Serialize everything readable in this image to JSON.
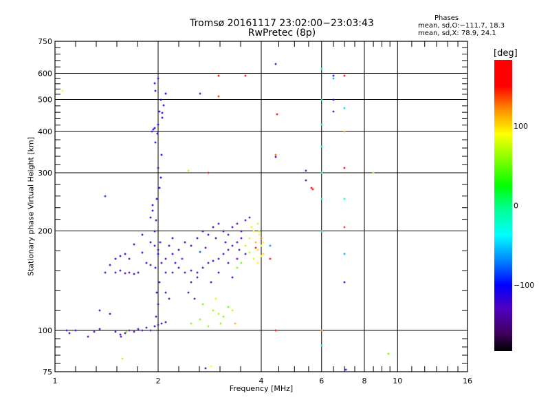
{
  "chart_data": {
    "type": "scatter",
    "title": "Tromsø 20161117 23:02:00−23:03:43",
    "subtitle": "RwPretec (8p)",
    "legend": {
      "heading": "Phases",
      "line_o": "mean, sd,O:−111.7, 18.3",
      "line_x": "mean, sd,X:  78.9, 24.1"
    },
    "xlabel": "Frequency [MHz]",
    "ylabel": "Stationary phase Virtual Height [km]",
    "xscale": "log",
    "yscale": "log",
    "xlim": [
      1,
      16
    ],
    "ylim": [
      75,
      750
    ],
    "xticks": [
      1,
      2,
      4,
      6,
      8,
      10,
      16
    ],
    "xtick_labels": [
      "1",
      "2",
      "4",
      "6",
      "8",
      "10",
      "16"
    ],
    "yticks": [
      75,
      100,
      200,
      300,
      400,
      500,
      600,
      750
    ],
    "ytick_labels": [
      "75",
      "100",
      "200",
      "300",
      "400",
      "500",
      "600",
      "750"
    ],
    "grid": true,
    "colorbar": {
      "unit": "[deg]",
      "range": [
        -183,
        183
      ],
      "ticks": [
        100,
        0,
        -100
      ],
      "tick_labels": [
        "100",
        "0",
        "−100"
      ],
      "stops": [
        [
          -183,
          "#000000"
        ],
        [
          -160,
          "#400060"
        ],
        [
          -130,
          "#5000c0"
        ],
        [
          -100,
          "#0000ff"
        ],
        [
          -70,
          "#0080ff"
        ],
        [
          -37,
          "#00ffff"
        ],
        [
          0,
          "#00ff80"
        ],
        [
          25,
          "#00ff00"
        ],
        [
          90,
          "#ffff00"
        ],
        [
          120,
          "#ff9000"
        ],
        [
          150,
          "#ff0000"
        ],
        [
          183,
          "#ff0000"
        ]
      ]
    },
    "point_fields": [
      "frequency_mhz",
      "height_km",
      "phase_deg"
    ],
    "points": [
      [
        1.08,
        100,
        -125
      ],
      [
        1.1,
        98,
        -120
      ],
      [
        1.15,
        100,
        -110
      ],
      [
        1.3,
        99,
        -130
      ],
      [
        1.35,
        101,
        -125
      ],
      [
        1.5,
        99,
        -110
      ],
      [
        1.55,
        97,
        -135
      ],
      [
        1.6,
        98,
        -130
      ],
      [
        1.65,
        100,
        -130
      ],
      [
        1.7,
        99,
        -130
      ],
      [
        1.75,
        101,
        -130
      ],
      [
        1.8,
        100,
        -130
      ],
      [
        1.85,
        102,
        -130
      ],
      [
        1.9,
        100,
        -125
      ],
      [
        1.95,
        103,
        -120
      ],
      [
        2.0,
        104,
        -125
      ],
      [
        2.05,
        105,
        -120
      ],
      [
        2.1,
        106,
        -125
      ],
      [
        1.56,
        96,
        -130
      ],
      [
        1.62,
        99,
        60
      ],
      [
        1.25,
        96,
        -130
      ],
      [
        1.45,
        112,
        -130
      ],
      [
        1.35,
        115,
        -120
      ],
      [
        1.5,
        150,
        -125
      ],
      [
        1.55,
        152,
        -125
      ],
      [
        1.6,
        149,
        -130
      ],
      [
        1.65,
        150,
        -125
      ],
      [
        1.7,
        148,
        -125
      ],
      [
        1.75,
        150,
        -120
      ],
      [
        1.5,
        165,
        -115
      ],
      [
        1.55,
        168,
        -120
      ],
      [
        1.6,
        170,
        -115
      ],
      [
        1.65,
        165,
        -130
      ],
      [
        1.8,
        172,
        -115
      ],
      [
        1.85,
        160,
        -120
      ],
      [
        1.9,
        158,
        -130
      ],
      [
        1.4,
        150,
        -130
      ],
      [
        1.45,
        158,
        -120
      ],
      [
        1.97,
        110,
        -110
      ],
      [
        2.0,
        120,
        -115
      ],
      [
        1.98,
        130,
        -110
      ],
      [
        2.02,
        140,
        -105
      ],
      [
        1.96,
        155,
        -110
      ],
      [
        2.0,
        170,
        -100
      ],
      [
        2.03,
        185,
        -110
      ],
      [
        1.95,
        200,
        -105
      ],
      [
        1.97,
        215,
        -110
      ],
      [
        1.93,
        230,
        -100
      ],
      [
        1.98,
        250,
        -110
      ],
      [
        2.02,
        270,
        -105
      ],
      [
        2.04,
        290,
        -100
      ],
      [
        2.0,
        310,
        -110
      ],
      [
        2.05,
        340,
        -100
      ],
      [
        1.96,
        370,
        -105
      ],
      [
        1.92,
        400,
        -110
      ],
      [
        1.95,
        410,
        -110
      ],
      [
        2.0,
        420,
        -100
      ],
      [
        2.06,
        440,
        -105
      ],
      [
        2.02,
        460,
        -110
      ],
      [
        2.08,
        480,
        -100
      ],
      [
        2.04,
        500,
        -105
      ],
      [
        1.96,
        530,
        -110
      ],
      [
        1.95,
        560,
        -100
      ],
      [
        2.0,
        580,
        -110
      ],
      [
        1.93,
        240,
        -110
      ],
      [
        1.9,
        220,
        -105
      ],
      [
        1.94,
        405,
        -105
      ],
      [
        2.06,
        455,
        -110
      ],
      [
        2.1,
        520,
        -100
      ],
      [
        1.99,
        395,
        -120
      ],
      [
        2.2,
        150,
        -125
      ],
      [
        2.3,
        155,
        -120
      ],
      [
        2.4,
        150,
        -125
      ],
      [
        2.5,
        152,
        -130
      ],
      [
        2.6,
        150,
        -120
      ],
      [
        2.7,
        155,
        -125
      ],
      [
        2.8,
        160,
        -120
      ],
      [
        2.9,
        162,
        -120
      ],
      [
        3.0,
        165,
        -130
      ],
      [
        3.1,
        170,
        -120
      ],
      [
        3.2,
        175,
        -125
      ],
      [
        3.3,
        180,
        -120
      ],
      [
        3.4,
        185,
        -125
      ],
      [
        3.5,
        190,
        -130
      ],
      [
        2.2,
        170,
        -115
      ],
      [
        2.3,
        175,
        -110
      ],
      [
        2.4,
        185,
        -110
      ],
      [
        2.5,
        180,
        -120
      ],
      [
        2.6,
        190,
        -115
      ],
      [
        2.7,
        200,
        -110
      ],
      [
        2.8,
        195,
        -115
      ],
      [
        2.9,
        205,
        -120
      ],
      [
        3.0,
        210,
        -125
      ],
      [
        3.1,
        200,
        -120
      ],
      [
        3.2,
        195,
        -125
      ],
      [
        3.3,
        205,
        -130
      ],
      [
        3.4,
        210,
        -125
      ],
      [
        3.5,
        200,
        -130
      ],
      [
        3.6,
        215,
        -125
      ],
      [
        3.7,
        220,
        -125
      ],
      [
        2.5,
        140,
        -130
      ],
      [
        2.6,
        145,
        -125
      ],
      [
        2.85,
        140,
        -120
      ],
      [
        3.0,
        150,
        -110
      ],
      [
        3.2,
        160,
        -130
      ],
      [
        3.4,
        165,
        -125
      ],
      [
        3.6,
        170,
        -120
      ],
      [
        3.3,
        145,
        -105
      ],
      [
        2.35,
        165,
        -90
      ],
      [
        2.65,
        173,
        -80
      ],
      [
        2.45,
        130,
        -120
      ],
      [
        2.55,
        125,
        -130
      ],
      [
        2.0,
        175,
        -120
      ],
      [
        2.05,
        160,
        -125
      ],
      [
        2.1,
        165,
        -130
      ],
      [
        2.15,
        180,
        -120
      ],
      [
        2.2,
        190,
        -110
      ],
      [
        2.1,
        150,
        -125
      ],
      [
        1.8,
        195,
        -115
      ],
      [
        1.9,
        185,
        -110
      ],
      [
        1.95,
        180,
        -120
      ],
      [
        1.7,
        182,
        -120
      ],
      [
        2.25,
        160,
        -125
      ],
      [
        2.75,
        178,
        -120
      ],
      [
        3.15,
        185,
        -115
      ],
      [
        3.45,
        175,
        -125
      ],
      [
        2.95,
        190,
        -130
      ],
      [
        2.15,
        125,
        -130
      ],
      [
        2.1,
        130,
        -125
      ],
      [
        3.6,
        180,
        100
      ],
      [
        3.7,
        190,
        95
      ],
      [
        3.8,
        200,
        90
      ],
      [
        3.85,
        185,
        110
      ],
      [
        3.9,
        175,
        100
      ],
      [
        3.95,
        195,
        85
      ],
      [
        4.0,
        180,
        90
      ],
      [
        4.05,
        170,
        100
      ],
      [
        3.8,
        165,
        80
      ],
      [
        3.9,
        160,
        95
      ],
      [
        4.0,
        168,
        85
      ],
      [
        3.7,
        172,
        70
      ],
      [
        3.5,
        160,
        55
      ],
      [
        3.4,
        155,
        50
      ],
      [
        3.75,
        205,
        95
      ],
      [
        3.9,
        210,
        100
      ],
      [
        3.85,
        178,
        150
      ],
      [
        4.0,
        190,
        130
      ],
      [
        3.95,
        200,
        75
      ],
      [
        4.05,
        185,
        95
      ],
      [
        2.7,
        120,
        50
      ],
      [
        2.9,
        115,
        60
      ],
      [
        3.0,
        112,
        70
      ],
      [
        3.1,
        110,
        55
      ],
      [
        3.2,
        118,
        50
      ],
      [
        3.3,
        115,
        75
      ],
      [
        3.05,
        105,
        60
      ],
      [
        3.35,
        105,
        110
      ],
      [
        2.5,
        105,
        55
      ],
      [
        2.8,
        103,
        60
      ],
      [
        2.95,
        125,
        80
      ],
      [
        2.65,
        108,
        60
      ],
      [
        6.0,
        620,
        -30
      ],
      [
        6.0,
        500,
        -20
      ],
      [
        6.0,
        420,
        -10
      ],
      [
        6.0,
        360,
        -20
      ],
      [
        6.0,
        300,
        -25
      ],
      [
        6.0,
        250,
        -15
      ],
      [
        6.0,
        200,
        -30
      ],
      [
        6.0,
        100,
        120
      ],
      [
        6.0,
        90,
        -40
      ],
      [
        6.5,
        590,
        -110
      ],
      [
        6.5,
        580,
        -60
      ],
      [
        6.5,
        500,
        -120
      ],
      [
        6.5,
        460,
        -130
      ],
      [
        7.0,
        590,
        150
      ],
      [
        7.0,
        470,
        -50
      ],
      [
        7.0,
        400,
        120
      ],
      [
        7.0,
        310,
        160
      ],
      [
        7.0,
        250,
        -20
      ],
      [
        7.0,
        205,
        140
      ],
      [
        7.0,
        170,
        -60
      ],
      [
        7.0,
        140,
        -110
      ],
      [
        5.4,
        305,
        -140
      ],
      [
        5.4,
        285,
        -140
      ],
      [
        5.6,
        270,
        170
      ],
      [
        5.65,
        268,
        170
      ],
      [
        4.4,
        640,
        -140
      ],
      [
        4.45,
        450,
        170
      ],
      [
        4.4,
        340,
        130
      ],
      [
        4.4,
        335,
        -110
      ],
      [
        3.6,
        590,
        170
      ],
      [
        3.0,
        590,
        170
      ],
      [
        3.0,
        510,
        140
      ],
      [
        2.65,
        520,
        -130
      ],
      [
        2.8,
        300,
        160
      ],
      [
        2.45,
        305,
        70
      ],
      [
        1.4,
        255,
        -90
      ],
      [
        1.05,
        530,
        90
      ],
      [
        9.4,
        85,
        50
      ],
      [
        8.5,
        300,
        60
      ],
      [
        4.4,
        100,
        160
      ],
      [
        2.75,
        77,
        -130
      ],
      [
        2.85,
        78,
        90
      ],
      [
        1.57,
        82,
        70
      ],
      [
        7.05,
        76,
        -100
      ],
      [
        4.25,
        180,
        -70
      ],
      [
        4.25,
        165,
        150
      ]
    ]
  }
}
